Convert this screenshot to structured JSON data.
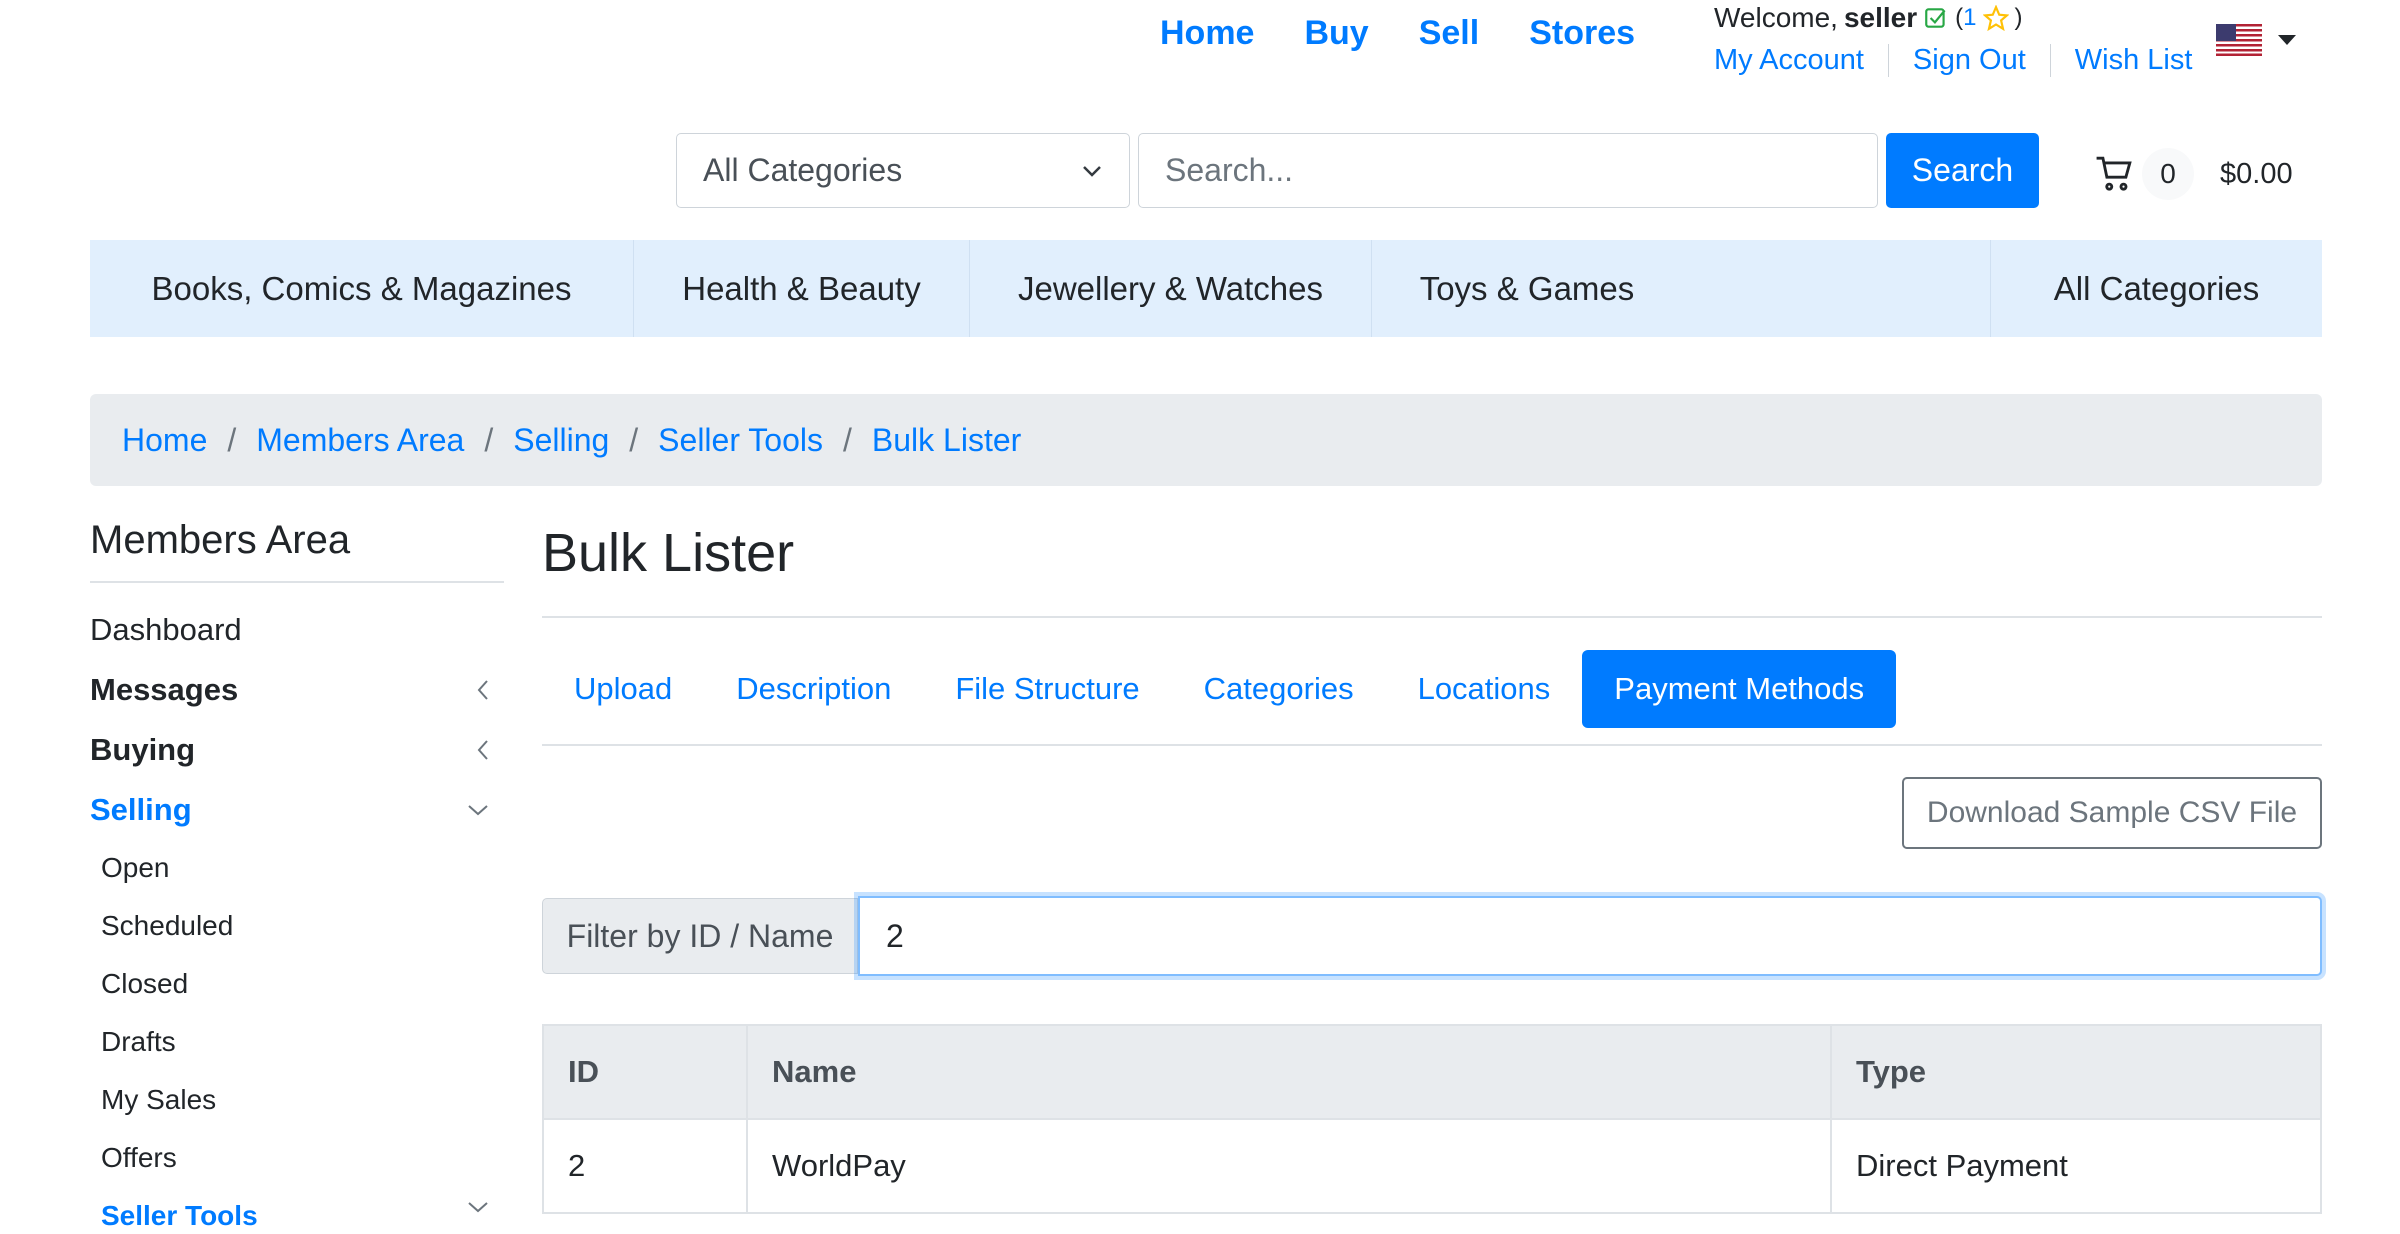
{
  "topnav": {
    "home": "Home",
    "buy": "Buy",
    "sell": "Sell",
    "stores": "Stores"
  },
  "user": {
    "welcome_prefix": "Welcome,",
    "username": "seller",
    "feedback_open": "(",
    "feedback_count": "1",
    "feedback_close": ")",
    "links": {
      "my_account": "My Account",
      "sign_out": "Sign Out",
      "wish_list": "Wish List"
    }
  },
  "search": {
    "category_selected": "All Categories",
    "placeholder": "Search...",
    "button_label": "Search"
  },
  "cart": {
    "count": "0",
    "total": "$0.00"
  },
  "category_bar": [
    "Books, Comics & Magazines",
    "Health & Beauty",
    "Jewellery & Watches",
    "Toys & Games",
    "All Categories"
  ],
  "breadcrumb": [
    "Home",
    "Members Area",
    "Selling",
    "Seller Tools",
    "Bulk Lister"
  ],
  "sidebar": {
    "title": "Members Area",
    "items": [
      "Dashboard",
      "Messages",
      "Buying",
      "Selling"
    ],
    "selling_sub": [
      "Open",
      "Scheduled",
      "Closed",
      "Drafts",
      "My Sales",
      "Offers",
      "Seller Tools"
    ]
  },
  "main": {
    "title": "Bulk Lister",
    "tabs": [
      "Upload",
      "Description",
      "File Structure",
      "Categories",
      "Locations",
      "Payment Methods"
    ],
    "active_tab": "Payment Methods",
    "download_button": "Download Sample CSV File",
    "filter_label": "Filter by ID / Name",
    "filter_value": "2",
    "table": {
      "headers": [
        "ID",
        "Name",
        "Type"
      ],
      "rows": [
        [
          "2",
          "WorldPay",
          "Direct Payment"
        ]
      ]
    }
  },
  "colors": {
    "accent": "#007bff",
    "category_bar_bg": "#e1effd",
    "breadcrumb_bg": "#e9ecef"
  }
}
